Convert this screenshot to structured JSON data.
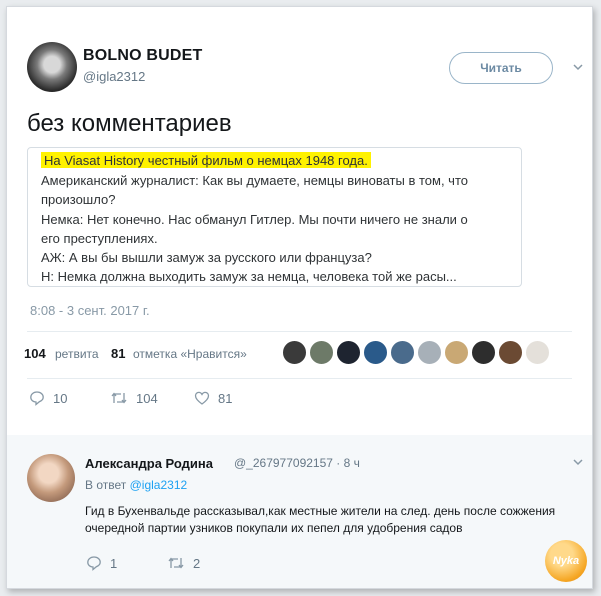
{
  "tweet": {
    "author_name": "BOLNO BUDET",
    "author_handle": "@igla2312",
    "follow_label": "Читать",
    "text": "без комментариев",
    "quote_lines": [
      "На Viasat History честный фильм о немцах 1948 года.",
      "Американский журналист: Как вы думаете, немцы виноваты в том, что",
      "произошло?",
      "Немка: Нет конечно. Нас обманул Гитлер. Мы почти ничего не знали о",
      "его преступлениях.",
      "АЖ: А вы бы вышли замуж за русского или француза?",
      "Н: Немка должна выходить замуж за немца, человека той же расы..."
    ],
    "timestamp": "8:08 - 3 сент. 2017 г.",
    "retweets_count": "104",
    "retweets_label": "ретвита",
    "likes_count": "81",
    "likes_label": "отметка «Нравится»",
    "actions": {
      "replies": "10",
      "retweets": "104",
      "likes": "81"
    }
  },
  "reply": {
    "author_name": "Александра Родина",
    "author_handle": "@_267977092157 · 8 ч",
    "in_reply_prefix": "В ответ",
    "in_reply_handle": "@igla2312",
    "text": "Гид в Бухенвальде рассказывал,как местные жители на след. день после сожжения очередной партии узников покупали их пепел для удобрения садов",
    "actions": {
      "replies": "1",
      "retweets": "2"
    }
  },
  "watermark": "Nyka",
  "colors": {
    "highlight": "#fff200",
    "link": "#1da1f2",
    "muted": "#657786"
  }
}
